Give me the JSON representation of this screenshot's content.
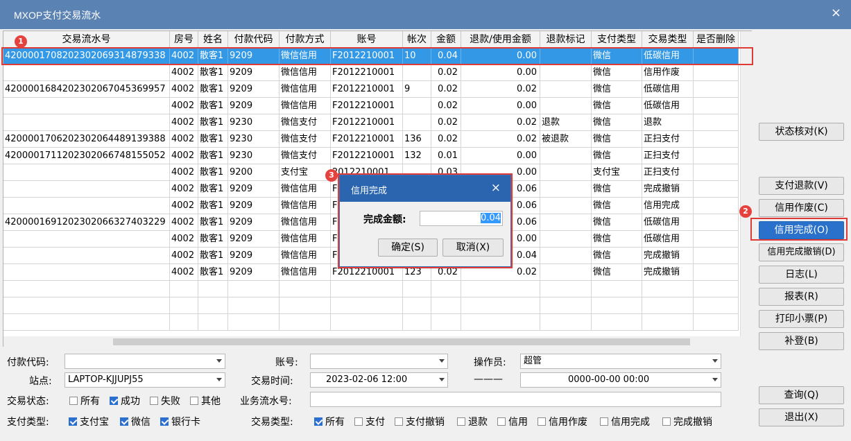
{
  "window": {
    "title": "MXOP支付交易流水",
    "close": "×"
  },
  "columns": [
    "交易流水号",
    "房号",
    "姓名",
    "付款代码",
    "付款方式",
    "账号",
    "帐次",
    "金额",
    "退款/使用金额",
    "退款标记",
    "支付类型",
    "交易类型",
    "是否删除"
  ],
  "rows": [
    [
      "4200001708202302069314879338",
      "4002",
      "散客1",
      "9209",
      "微信信用",
      "F2012210001",
      "10",
      "0.04",
      "0.00",
      "",
      "微信",
      "低碳信用",
      ""
    ],
    [
      "",
      "4002",
      "散客1",
      "9209",
      "微信信用",
      "F2012210001",
      "",
      "0.02",
      "0.00",
      "",
      "微信",
      "信用作废",
      ""
    ],
    [
      "4200001684202302067045369957",
      "4002",
      "散客1",
      "9209",
      "微信信用",
      "F2012210001",
      "9",
      "0.02",
      "0.02",
      "",
      "微信",
      "低碳信用",
      ""
    ],
    [
      "",
      "4002",
      "散客1",
      "9209",
      "微信信用",
      "F2012210001",
      "",
      "0.02",
      "0.00",
      "",
      "微信",
      "低碳信用",
      ""
    ],
    [
      "",
      "4002",
      "散客1",
      "9230",
      "微信支付",
      "F2012210001",
      "",
      "0.02",
      "0.02",
      "退款",
      "微信",
      "退款",
      ""
    ],
    [
      "4200001706202302064489139388",
      "4002",
      "散客1",
      "9230",
      "微信支付",
      "F2012210001",
      "136",
      "0.02",
      "0.02",
      "被退款",
      "微信",
      "正扫支付",
      ""
    ],
    [
      "4200001711202302066748155052",
      "4002",
      "散客1",
      "9230",
      "微信支付",
      "F2012210001",
      "132",
      "0.01",
      "0.00",
      "",
      "微信",
      "正扫支付",
      ""
    ],
    [
      "",
      "4002",
      "散客1",
      "9200",
      "支付宝",
      "2012210001",
      "",
      "0.03",
      "0.00",
      "",
      "支付宝",
      "正扫支付",
      ""
    ],
    [
      "",
      "4002",
      "散客1",
      "9209",
      "微信信用",
      "F",
      "",
      "",
      "0.06",
      "",
      "微信",
      "完成撤销",
      ""
    ],
    [
      "",
      "4002",
      "散客1",
      "9209",
      "微信信用",
      "F",
      "",
      "",
      "0.06",
      "",
      "微信",
      "信用完成",
      ""
    ],
    [
      "4200001691202302066327403229",
      "4002",
      "散客1",
      "9209",
      "微信信用",
      "F",
      "",
      "",
      "0.06",
      "",
      "微信",
      "低碳信用",
      ""
    ],
    [
      "",
      "4002",
      "散客1",
      "9209",
      "微信信用",
      "F",
      "",
      "",
      "0.00",
      "",
      "微信",
      "低碳信用",
      ""
    ],
    [
      "",
      "4002",
      "散客1",
      "9209",
      "微信信用",
      "F",
      "",
      "",
      "0.04",
      "",
      "微信",
      "完成撤销",
      ""
    ],
    [
      "",
      "4002",
      "散客1",
      "9209",
      "微信信用",
      "F2012210001",
      "123",
      "0.02",
      "0.02",
      "",
      "微信",
      "完成撤销",
      ""
    ]
  ],
  "side_buttons": [
    {
      "label": "状态核对(K)",
      "name": "status-check-button"
    },
    {
      "label": "支付退款(V)",
      "name": "payment-refund-button"
    },
    {
      "label": "信用作废(C)",
      "name": "credit-void-button"
    },
    {
      "label": "信用完成(O)",
      "name": "credit-complete-button"
    },
    {
      "label": "信用完成撤销(D)",
      "name": "credit-complete-undo-button"
    },
    {
      "label": "日志(L)",
      "name": "log-button"
    },
    {
      "label": "报表(R)",
      "name": "report-button"
    },
    {
      "label": "打印小票(P)",
      "name": "print-receipt-button"
    },
    {
      "label": "补登(B)",
      "name": "supplement-button"
    },
    {
      "label": "查询(Q)",
      "name": "query-button"
    },
    {
      "label": "退出(X)",
      "name": "exit-button"
    }
  ],
  "badges": [
    "1",
    "2",
    "3"
  ],
  "dialog": {
    "title": "信用完成",
    "close": "×",
    "amount_label": "完成金额:",
    "amount_value": "0.04",
    "ok": "确定(S)",
    "cancel": "取消(X)"
  },
  "filters": {
    "pay_code_label": "付款代码:",
    "pay_code_value": "",
    "account_label": "账号:",
    "account_value": "",
    "operator_label": "操作员:",
    "operator_value": "超管",
    "station_label": "站点:",
    "station_value": "LAPTOP-KJJUPJ55",
    "time_label": "交易时间:",
    "time_from": "2023-02-06 12:00",
    "time_sep": "———",
    "time_to": "0000-00-00 00:00",
    "state_label": "交易状态:",
    "biz_no_label": "业务流水号:",
    "biz_no_value": "",
    "paytype_label": "支付类型:",
    "trantype_label": "交易类型:"
  },
  "state_options": [
    {
      "label": "所有",
      "checked": false
    },
    {
      "label": "成功",
      "checked": true
    },
    {
      "label": "失败",
      "checked": false
    },
    {
      "label": "其他",
      "checked": false
    }
  ],
  "paytype_options": [
    {
      "label": "支付宝",
      "checked": true
    },
    {
      "label": "微信",
      "checked": true
    },
    {
      "label": "银行卡",
      "checked": true
    }
  ],
  "trantype_options": [
    {
      "label": "所有",
      "checked": true
    },
    {
      "label": "支付",
      "checked": false
    },
    {
      "label": "支付撤销",
      "checked": false
    },
    {
      "label": "退款",
      "checked": false
    },
    {
      "label": "信用",
      "checked": false
    },
    {
      "label": "信用作废",
      "checked": false
    },
    {
      "label": "信用完成",
      "checked": false
    },
    {
      "label": "完成撤销",
      "checked": false
    }
  ]
}
